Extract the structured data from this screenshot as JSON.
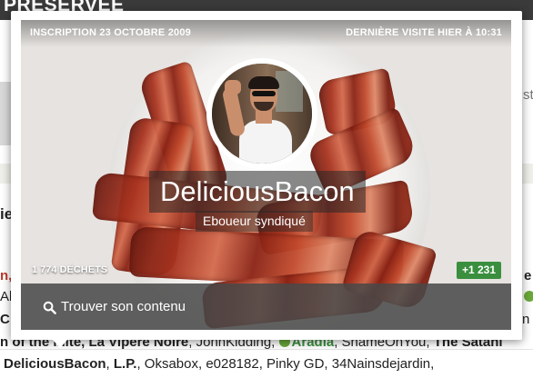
{
  "background_page": {
    "section_title": "PRÉSERVÉE",
    "visible_fragments": {
      "right_st": "st",
      "left_ie": "ie",
      "left_n": "n,",
      "left_al": "Al",
      "right_e": "e",
      "right_n": "n",
      "left_c": "C",
      "row_text_1": "n of the ",
      "row_text_1b": "inite",
      "row_text_2": ", La Vipère Noire",
      "row_text_3": ", JohnKidding, ",
      "row_text_4": "Aradia",
      "row_text_5": ", ShameOnYou, ",
      "row_text_6": "The Satani"
    },
    "user_list": {
      "first": "DeliciousBacon",
      "second": "L.P.",
      "rest": ", Oksabox, e028182, Pinky GD, 34Nainsdejardin, "
    }
  },
  "popup": {
    "registration": "INSCRIPTION 23 OCTOBRE 2009",
    "last_visit": "DERNIÈRE VISITE HIER À 10:31",
    "username": "DeliciousBacon",
    "user_title": "Eboueur syndiqué",
    "waste_count": "1 774 DÉCHETS",
    "score": "+1 231",
    "find_content_label": "Trouver son contenu",
    "accent_color": "#3a8f3e",
    "icons": {
      "find": "search-icon"
    }
  }
}
